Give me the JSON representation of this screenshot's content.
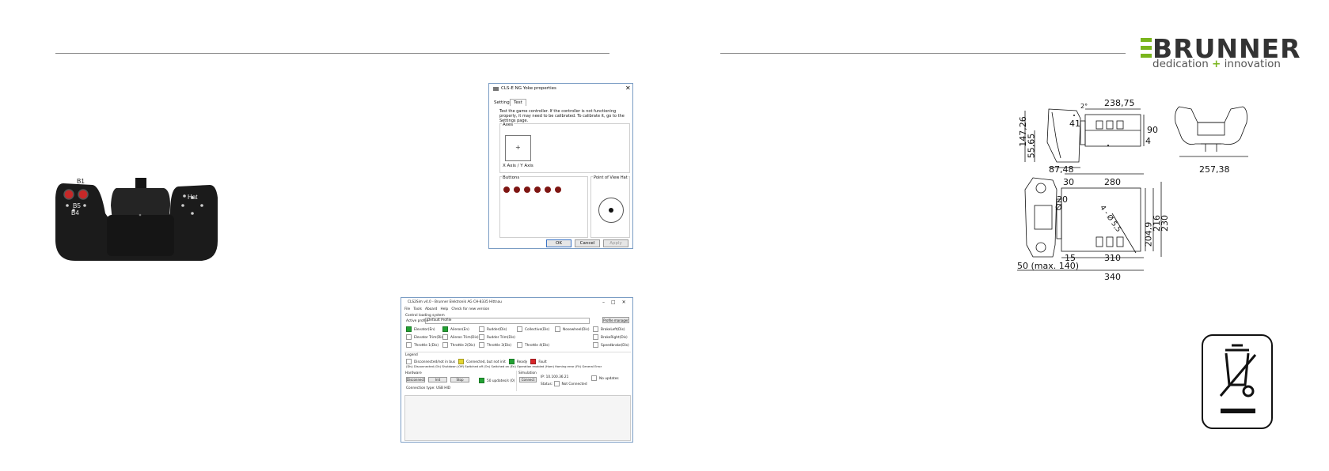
{
  "logo": {
    "word": "BRUNNER",
    "tag_left": "dedication",
    "tag_plus": "+",
    "tag_right": "innovation",
    "accent": "#7ab51d"
  },
  "yoke": {
    "labels": {
      "b1": "B1",
      "b5": "B5",
      "b4": "B4",
      "hat": "Hat"
    }
  },
  "properties_dialog": {
    "title": "CLS-E NG Yoke properties",
    "tabs": [
      "Settings",
      "Test"
    ],
    "instructions": "Test the game controller. If the controller is not functioning properly, it may need to be calibrated. To calibrate it, go to the Settings page.",
    "axes_label": "Axes",
    "axes_caption": "X Axis / Y Axis",
    "buttons_label": "Buttons",
    "button_count": 6,
    "pov_label": "Point of View Hat",
    "ok": "OK",
    "cancel": "Cancel",
    "apply": "Apply"
  },
  "cls2sim": {
    "title": "CLS2Sim v4.0 - Brunner Elektronik AG CH-8335 Hittnau",
    "menu": [
      "File",
      "Tools",
      "Aboard",
      "Help",
      "Check for new version"
    ],
    "profile_section": "Control loading system",
    "profile_label": "Active profile",
    "profile_value": "Default Profile",
    "profile_manager": "Profile manager",
    "axes": [
      [
        {
          "label": "Elevator(En)",
          "state": "g"
        },
        {
          "label": "Aileron(En)",
          "state": "g"
        },
        {
          "label": "Rudder(Dis)",
          "state": ""
        },
        {
          "label": "Collective(Dis)",
          "state": ""
        },
        {
          "label": "Nosewheel(Dis)",
          "state": ""
        },
        {
          "label": "BrakeLeft(Dis)",
          "state": ""
        }
      ],
      [
        {
          "label": "Elevator Trim(Dis)",
          "state": ""
        },
        {
          "label": "Aileron Trim(Dis)",
          "state": ""
        },
        {
          "label": "Rudder Trim(Dis)",
          "state": ""
        },
        {
          "label": "",
          "state": "none"
        },
        {
          "label": "",
          "state": "none"
        },
        {
          "label": "BrakeRight(Dis)",
          "state": ""
        }
      ],
      [
        {
          "label": "Throttle 1(Dis)",
          "state": ""
        },
        {
          "label": "Throttle 2(Dis)",
          "state": ""
        },
        {
          "label": "Throttle 3(Dis)",
          "state": ""
        },
        {
          "label": "Throttle 4(Dis)",
          "state": ""
        },
        {
          "label": "",
          "state": "none"
        },
        {
          "label": "Speedbrake(Dis)",
          "state": ""
        }
      ]
    ],
    "legend_title": "Legend",
    "legend": [
      {
        "label": "Disconnected/not in bus",
        "state": ""
      },
      {
        "label": "Connected, but not init",
        "state": "y"
      },
      {
        "label": "Ready",
        "state": "g"
      },
      {
        "label": "Fault",
        "state": "r"
      }
    ],
    "legend_codes": "(Dis) Disconnected   (Ok) Shutdown   (Off) Switched off   (On) Switched on   (En) Operation enabled   (Hom) Homing error   (Flt) General Error",
    "hardware_title": "Hardware",
    "hw_buttons": [
      "Disconnect",
      "Init",
      "Stop"
    ],
    "updates_label": "50 updates/s (0)",
    "connection": "Connection type: USB HID",
    "sim_title": "Simulation",
    "connect": "Connect",
    "ip": "IP: 10.100.36.21",
    "status_label": "Status:",
    "status_value": "Not Connected",
    "no_updates": "No updates"
  },
  "drawing": {
    "dims": [
      "238,75",
      "2°",
      "41",
      "147,26",
      "55,65",
      "87,48",
      "4",
      "90",
      "257,38",
      "30",
      "280",
      "20",
      "Ø",
      "204,9",
      "216",
      "230",
      "4 - Ø 5,5",
      "15",
      "310",
      "50 (max. 140)",
      "340"
    ]
  }
}
